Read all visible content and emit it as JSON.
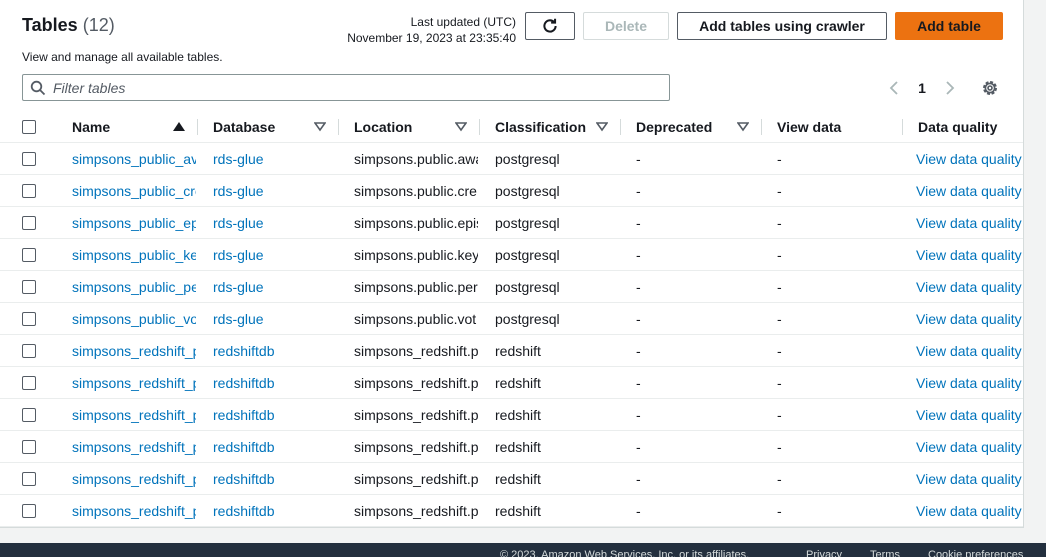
{
  "header": {
    "title": "Tables",
    "count": "(12)",
    "subtitle": "View and manage all available tables.",
    "last_updated_label": "Last updated (UTC)",
    "last_updated_value": "November 19, 2023 at 23:35:40"
  },
  "buttons": {
    "delete": "Delete",
    "add_crawler": "Add tables using crawler",
    "add_table": "Add table"
  },
  "filter": {
    "placeholder": "Filter tables",
    "value": ""
  },
  "pagination": {
    "current_page": "1"
  },
  "columns": {
    "name": "Name",
    "database": "Database",
    "location": "Location",
    "classification": "Classification",
    "deprecated": "Deprecated",
    "view_data": "View data",
    "data_quality": "Data quality"
  },
  "rows": [
    {
      "name": "simpsons_public_av",
      "database": "rds-glue",
      "location": "simpsons.public.awa",
      "classification": "postgresql",
      "deprecated": "-",
      "view_data": "-",
      "data_quality": "View data quality"
    },
    {
      "name": "simpsons_public_cre",
      "database": "rds-glue",
      "location": "simpsons.public.cre",
      "classification": "postgresql",
      "deprecated": "-",
      "view_data": "-",
      "data_quality": "View data quality"
    },
    {
      "name": "simpsons_public_ep",
      "database": "rds-glue",
      "location": "simpsons.public.epis",
      "classification": "postgresql",
      "deprecated": "-",
      "view_data": "-",
      "data_quality": "View data quality"
    },
    {
      "name": "simpsons_public_ke",
      "database": "rds-glue",
      "location": "simpsons.public.key",
      "classification": "postgresql",
      "deprecated": "-",
      "view_data": "-",
      "data_quality": "View data quality"
    },
    {
      "name": "simpsons_public_pe",
      "database": "rds-glue",
      "location": "simpsons.public.per",
      "classification": "postgresql",
      "deprecated": "-",
      "view_data": "-",
      "data_quality": "View data quality"
    },
    {
      "name": "simpsons_public_vo",
      "database": "rds-glue",
      "location": "simpsons.public.vot",
      "classification": "postgresql",
      "deprecated": "-",
      "view_data": "-",
      "data_quality": "View data quality"
    },
    {
      "name": "simpsons_redshift_p",
      "database": "redshiftdb",
      "location": "simpsons_redshift.p",
      "classification": "redshift",
      "deprecated": "-",
      "view_data": "-",
      "data_quality": "View data quality"
    },
    {
      "name": "simpsons_redshift_p",
      "database": "redshiftdb",
      "location": "simpsons_redshift.p",
      "classification": "redshift",
      "deprecated": "-",
      "view_data": "-",
      "data_quality": "View data quality"
    },
    {
      "name": "simpsons_redshift_p",
      "database": "redshiftdb",
      "location": "simpsons_redshift.p",
      "classification": "redshift",
      "deprecated": "-",
      "view_data": "-",
      "data_quality": "View data quality"
    },
    {
      "name": "simpsons_redshift_p",
      "database": "redshiftdb",
      "location": "simpsons_redshift.p",
      "classification": "redshift",
      "deprecated": "-",
      "view_data": "-",
      "data_quality": "View data quality"
    },
    {
      "name": "simpsons_redshift_p",
      "database": "redshiftdb",
      "location": "simpsons_redshift.p",
      "classification": "redshift",
      "deprecated": "-",
      "view_data": "-",
      "data_quality": "View data quality"
    },
    {
      "name": "simpsons_redshift_p",
      "database": "redshiftdb",
      "location": "simpsons_redshift.p",
      "classification": "redshift",
      "deprecated": "-",
      "view_data": "-",
      "data_quality": "View data quality"
    }
  ],
  "footer": {
    "copyright": "© 2023, Amazon Web Services, Inc. or its affiliates.",
    "privacy": "Privacy",
    "terms": "Terms",
    "cookies": "Cookie preferences"
  },
  "icons": {
    "refresh": "refresh-icon",
    "search": "search-icon",
    "prev": "chevron-left-icon",
    "next": "chevron-right-icon",
    "settings": "gear-icon",
    "sort_asc": "sort-ascending-icon",
    "sort": "sort-caret-down-icon"
  },
  "colors": {
    "primary_button": "#ec7211",
    "link": "#0073bb",
    "footer_bg": "#232f3e"
  }
}
